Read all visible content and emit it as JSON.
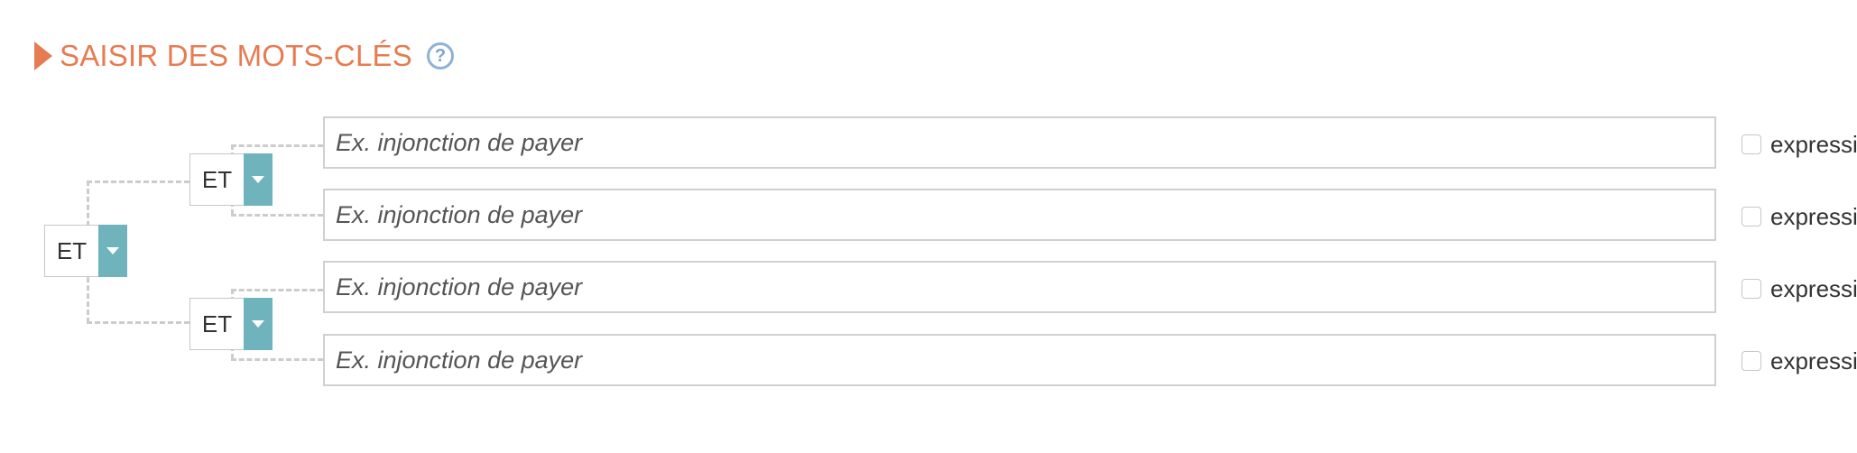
{
  "header": {
    "title": "SAISIR DES MOTS-CLÉS",
    "help_icon": "question-circle-icon",
    "help_glyph": "?"
  },
  "operators": {
    "root": {
      "label": "ET"
    },
    "group_1": {
      "label": "ET"
    },
    "group_2": {
      "label": "ET"
    }
  },
  "keywords": [
    {
      "value": "",
      "placeholder": "Ex. injonction de payer",
      "expression_label": "expressi"
    },
    {
      "value": "",
      "placeholder": "Ex. injonction de payer",
      "expression_label": "expressi"
    },
    {
      "value": "",
      "placeholder": "Ex. injonction de payer",
      "expression_label": "expressi"
    },
    {
      "value": "",
      "placeholder": "Ex. injonction de payer",
      "expression_label": "expressi"
    }
  ],
  "colors": {
    "accent": "#e67c52",
    "operator_button": "#6fb3bd",
    "help_icon": "#8fb1d6",
    "connector": "#cccccc"
  }
}
